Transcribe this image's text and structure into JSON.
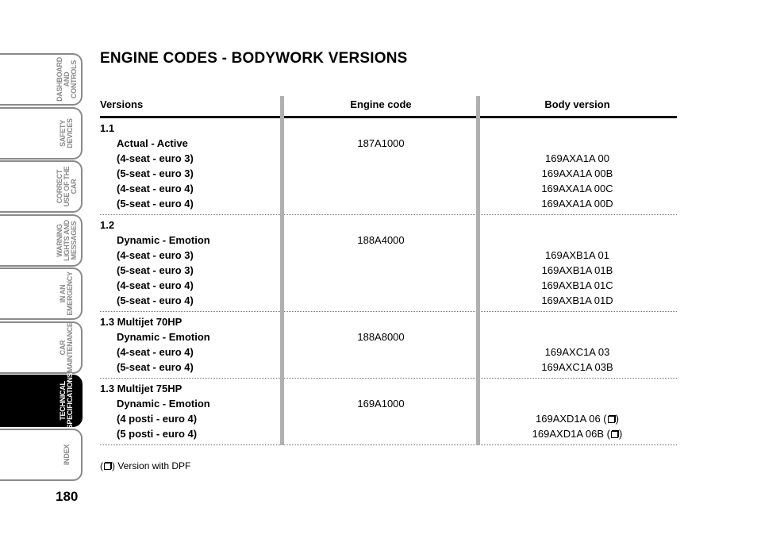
{
  "side_tabs": [
    {
      "label": "DASHBOARD AND CONTROLS",
      "active": false
    },
    {
      "label": "SAFETY DEVICES",
      "active": false
    },
    {
      "label": "CORRECT USE OF THE CAR",
      "active": false
    },
    {
      "label": "WARNING LIGHTS AND MESSAGES",
      "active": false
    },
    {
      "label": "IN AN EMERGENCY",
      "active": false
    },
    {
      "label": "CAR MAINTENANCE",
      "active": false
    },
    {
      "label": "TECHNICAL SPECIFICATIONS",
      "active": true
    },
    {
      "label": "INDEX",
      "active": false
    }
  ],
  "page_number": "180",
  "title": "ENGINE CODES - BODYWORK VERSIONS",
  "table": {
    "headers": {
      "versions": "Versions",
      "engine_code": "Engine code",
      "body_version": "Body version"
    },
    "groups": [
      {
        "version": "1.1",
        "rows": [
          {
            "version": "Actual - Active",
            "engine_code": "187A1000",
            "body_version": ""
          },
          {
            "version": "(4-seat - euro 3)",
            "engine_code": "",
            "body_version": "169AXA1A 00"
          },
          {
            "version": "(5-seat - euro 3)",
            "engine_code": "",
            "body_version": "169AXA1A 00B"
          },
          {
            "version": "(4-seat - euro 4)",
            "engine_code": "",
            "body_version": "169AXA1A 00C"
          },
          {
            "version": "(5-seat - euro 4)",
            "engine_code": "",
            "body_version": "169AXA1A 00D"
          }
        ]
      },
      {
        "version": "1.2",
        "rows": [
          {
            "version": "Dynamic - Emotion",
            "engine_code": "188A4000",
            "body_version": ""
          },
          {
            "version": "(4-seat - euro 3)",
            "engine_code": "",
            "body_version": "169AXB1A 01"
          },
          {
            "version": "(5-seat - euro 3)",
            "engine_code": "",
            "body_version": "169AXB1A 01B"
          },
          {
            "version": "(4-seat - euro 4)",
            "engine_code": "",
            "body_version": "169AXB1A 01C"
          },
          {
            "version": "(5-seat - euro 4)",
            "engine_code": "",
            "body_version": "169AXB1A 01D"
          }
        ]
      },
      {
        "version": "1.3 Multijet 70HP",
        "rows": [
          {
            "version": "Dynamic - Emotion",
            "engine_code": "188A8000",
            "body_version": ""
          },
          {
            "version": "(4-seat - euro 4)",
            "engine_code": "",
            "body_version": "169AXC1A 03"
          },
          {
            "version": "(5-seat - euro 4)",
            "engine_code": "",
            "body_version": "169AXC1A 03B"
          }
        ]
      },
      {
        "version": "1.3 Multijet 75HP",
        "rows": [
          {
            "version": "Dynamic - Emotion",
            "engine_code": "169A1000",
            "body_version": "",
            "dpf": false
          },
          {
            "version": "(4 posti - euro 4)",
            "engine_code": "",
            "body_version": "169AXD1A 06",
            "dpf": true
          },
          {
            "version": "(5 posti - euro 4)",
            "engine_code": "",
            "body_version": "169AXD1A 06B",
            "dpf": true
          }
        ]
      }
    ]
  },
  "note": {
    "symbol": "dpf-symbol",
    "text": "Version with DPF"
  }
}
